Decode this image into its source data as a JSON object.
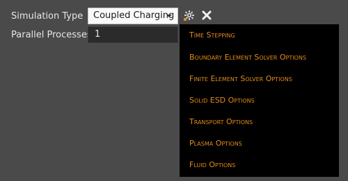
{
  "form": {
    "simulation_type_label": "Simulation Type",
    "simulation_type_value": "Coupled Charging",
    "parallel_processes_label": "Parallel Processes",
    "parallel_processes_value": "1"
  },
  "toolbar": {
    "settings_icon": "gear-icon",
    "close_icon": "close-icon"
  },
  "menu": {
    "items": [
      {
        "label": "Time Stepping"
      },
      {
        "label": "Boundary Element Solver Options"
      },
      {
        "label": "Finite Element Solver Options"
      },
      {
        "label": "Solid ESD Options"
      },
      {
        "label": "Transport Options"
      },
      {
        "label": "Plasma Options"
      },
      {
        "label": "Fluid Options"
      }
    ]
  },
  "colors": {
    "background": "#4a4a4a",
    "menu_background": "#000000",
    "menu_text": "#e48a1c",
    "label_text": "#e6e6e6",
    "input_background": "#2b2b2b",
    "combo_background": "#fafafa"
  }
}
